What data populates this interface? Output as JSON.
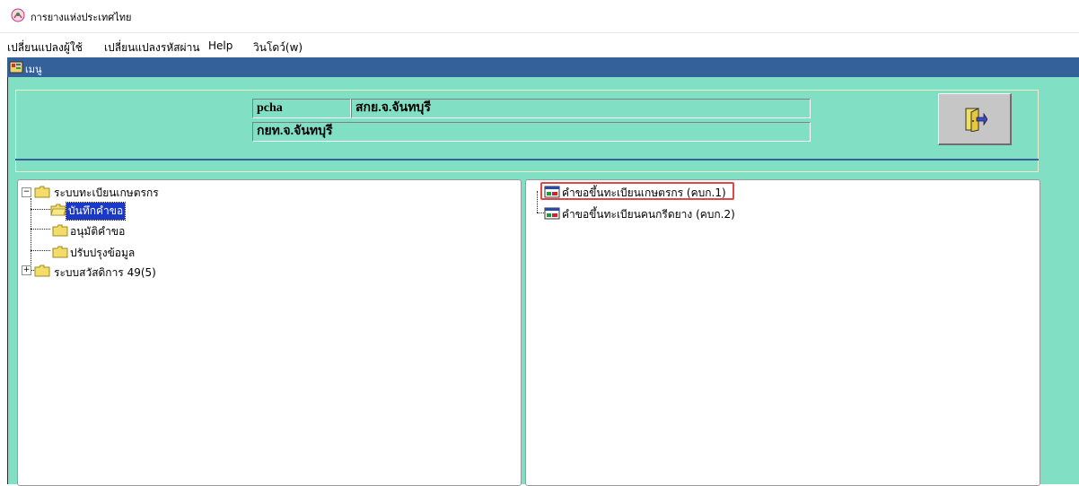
{
  "window": {
    "title": "การยางแห่งประเทศไทย"
  },
  "menu": {
    "items": [
      {
        "label": "เปลี่ยนแปลงผู้ใช้"
      },
      {
        "label": "เปลี่ยนแปลงรหัสผ่าน"
      },
      {
        "label": "Help"
      },
      {
        "label": "วินโดว์(w)"
      }
    ]
  },
  "inner_window": {
    "title": "เมนู"
  },
  "user_info": {
    "username": "pcha",
    "office": "สกย.จ.จันทบุรี",
    "department": "กยท.จ.จันทบุรี"
  },
  "tree": {
    "nodes": [
      {
        "label": "ระบบทะเบียนเกษตรกร",
        "expanded": true
      },
      {
        "label": "บันทึกคำขอ",
        "selected": true
      },
      {
        "label": "อนุมัติคำขอ"
      },
      {
        "label": "ปรับปรุงข้อมูล"
      },
      {
        "label": "ระบบสวัสดิการ 49(5)",
        "expanded": false
      }
    ]
  },
  "forms": {
    "items": [
      {
        "label": "คำขอขึ้นทะเบียนเกษตรกร (คบก.1)",
        "highlighted": true
      },
      {
        "label": "คำขอขึ้นทะเบียนคนกรีดยาง (คบก.2)"
      }
    ]
  },
  "colors": {
    "client_bg": "#81e0c4",
    "title_bar": "#35619a",
    "selection": "#1a39c8",
    "highlight": "#e04848"
  }
}
